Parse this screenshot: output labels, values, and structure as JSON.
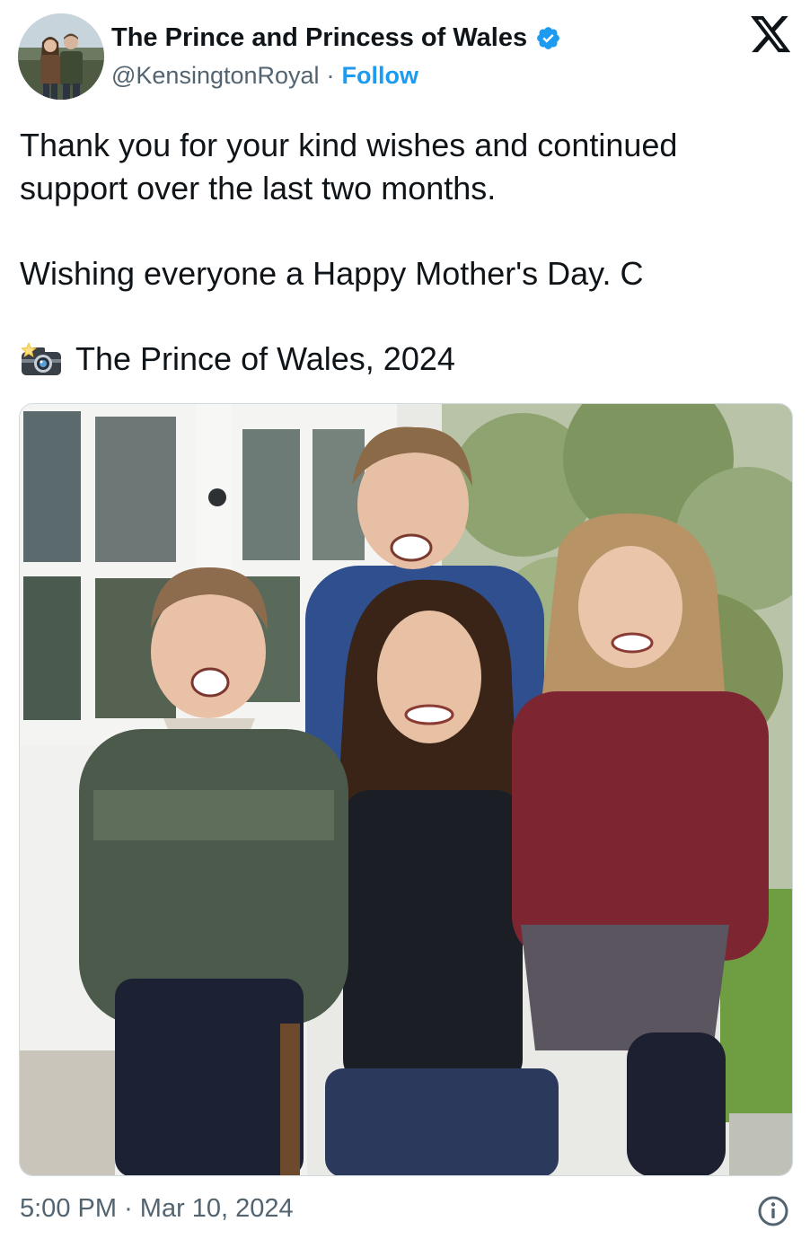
{
  "author": {
    "display_name": "The Prince and Princess of Wales",
    "handle": "@KensingtonRoyal",
    "separator": "·",
    "follow_label": "Follow",
    "verified": true,
    "avatar": "avatar-photo-couple"
  },
  "brand": {
    "logo": "x-logo-icon"
  },
  "tweet": {
    "line1": "Thank you for your kind wishes and continued",
    "line2": "support over the last two months.",
    "line3": "Wishing everyone a Happy Mother's Day. C",
    "credit_emoji": "camera-with-flash-icon",
    "credit": "The Prince of Wales, 2024"
  },
  "media": {
    "type": "photo",
    "alt": "family-photo"
  },
  "meta": {
    "time": "5:00 PM",
    "separator": "·",
    "date": "Mar 10, 2024",
    "info": "info-icon"
  },
  "colors": {
    "text": "#0f1419",
    "secondary": "#536471",
    "accent": "#1d9bf0",
    "border": "#cfd9de"
  }
}
